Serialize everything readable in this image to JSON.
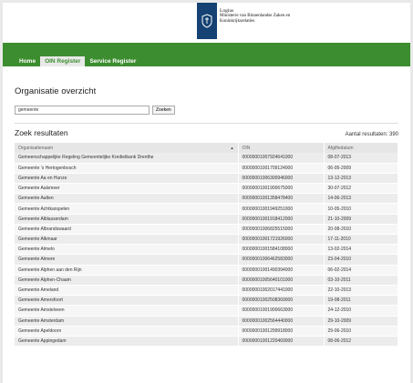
{
  "header": {
    "logo_line1": "Logius",
    "logo_line2": "Ministerie van Binnenlandse Zaken en",
    "logo_line3": "Koninkrijksrelaties",
    "brand_color": "#154273"
  },
  "nav": {
    "items": [
      {
        "label": "Home",
        "active": false
      },
      {
        "label": "OIN Register",
        "active": true
      },
      {
        "label": "Service Register",
        "active": false
      }
    ],
    "bar_color": "#3c8d2f"
  },
  "main": {
    "title": "Organisatie overzicht",
    "search_value": "gemeente",
    "search_button": "Zoeken",
    "results_title": "Zoek resultaten",
    "results_count": "Aantal resultaten: 390"
  },
  "table": {
    "columns": [
      "Organisatienaam",
      "OIN",
      "Afgiftedatum"
    ],
    "rows": [
      [
        "Gemeenschappelijke Regeling Gemeentelijke Kredietbank Drenthe",
        "00000001007924641000",
        "08-07-2013"
      ],
      [
        "Gemeente 's Hertogenbosch",
        "00000001001709124000",
        "06-05-2009"
      ],
      [
        "Gemeente Aa en Hunze",
        "00000001006300946000",
        "13-12-2013"
      ],
      [
        "Gemeente Aalsmeer",
        "00000001001900675000",
        "30-07-2012"
      ],
      [
        "Gemeente Aalten",
        "00000001001358478400",
        "14-06-2013"
      ],
      [
        "Gemeente Achtkarspelen",
        "00000001001949251000",
        "10-05-2010"
      ],
      [
        "Gemeente Alblasserdam",
        "00000001001918412000",
        "21-10-2009"
      ],
      [
        "Gemeente Albrandswaard",
        "00000001006825515000",
        "20-08-2010"
      ],
      [
        "Gemeente Alkmaar",
        "00000001001721926000",
        "17-11-2010"
      ],
      [
        "Gemeente Almelo",
        "00000001001584108000",
        "13-02-2014"
      ],
      [
        "Gemeente Almere",
        "00000001006462583000",
        "23-04-2010"
      ],
      [
        "Gemeente Alphen aan den Rijn",
        "00000001001490394000",
        "06-02-2014"
      ],
      [
        "Gemeente Alphen-Chaam",
        "00000001005640101000",
        "03-10-2011"
      ],
      [
        "Gemeente Ameland",
        "00000001002017441000",
        "22-10-2013"
      ],
      [
        "Gemeente Amersfoort",
        "00000001002508369000",
        "19-08-2011"
      ],
      [
        "Gemeente Amstelveen",
        "00000001001900663000",
        "24-12-2010"
      ],
      [
        "Gemeente Amsterdam",
        "00000001002564440000",
        "29-10-2009"
      ],
      [
        "Gemeente Apeldoorn",
        "00000001001299918000",
        "29-06-2010"
      ],
      [
        "Gemeente Appingedam",
        "00000001001220469000",
        "08-06-2012"
      ]
    ]
  }
}
